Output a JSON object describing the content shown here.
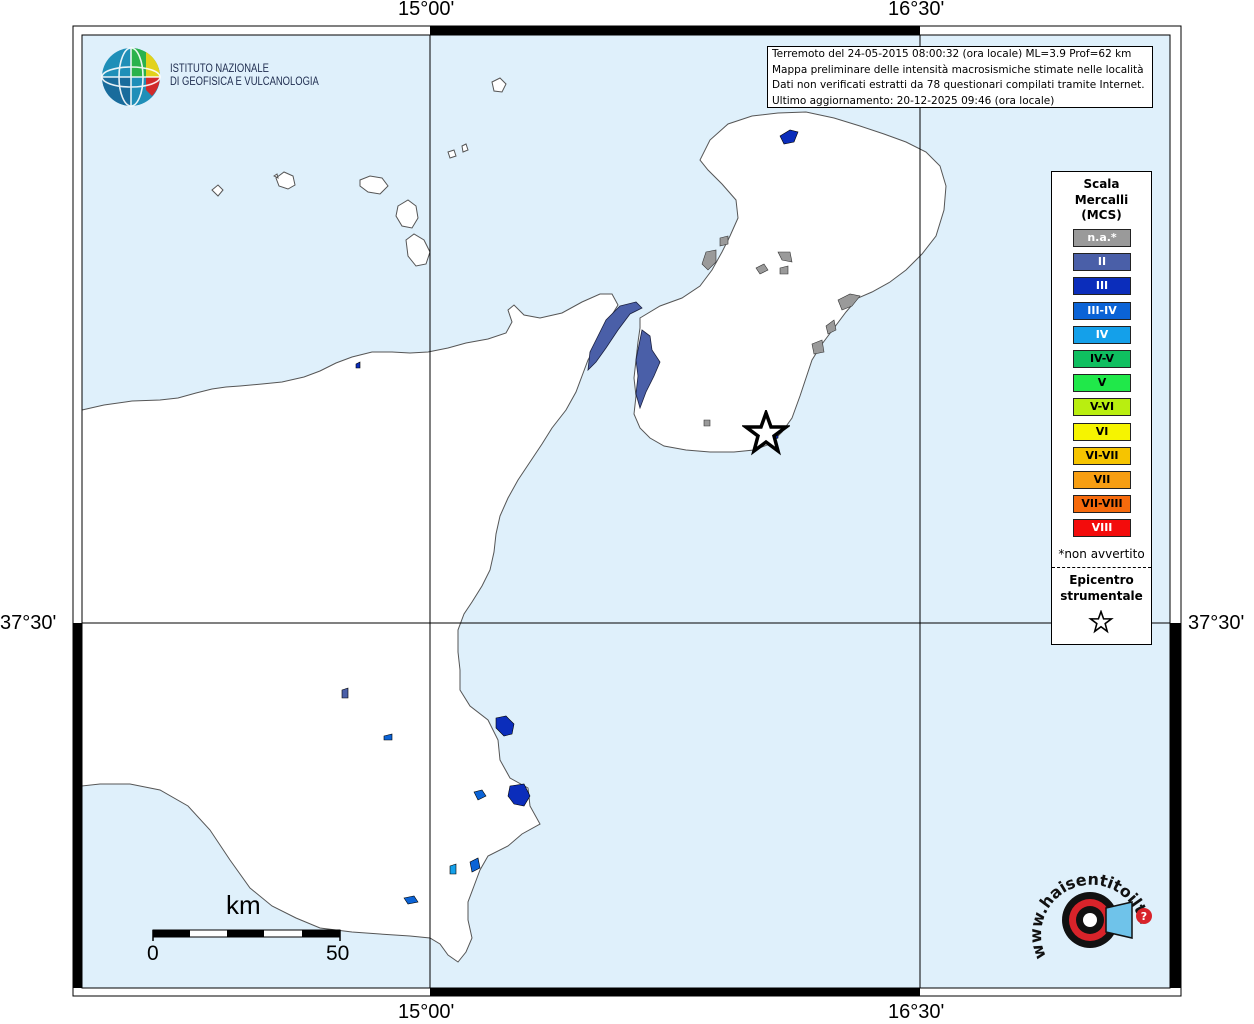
{
  "map": {
    "coords": {
      "top_left": "15°00'",
      "top_right": "16°30'",
      "bottom_left": "15°00'",
      "bottom_right": "16°30'",
      "left_lat": "37°30'",
      "right_lat": "37°30'"
    },
    "colors": {
      "sea": "#dff0fb",
      "land": "#ffffff",
      "coast": "#555555",
      "grid": "#000000"
    },
    "epicenter_symbol": "star-icon"
  },
  "info": {
    "line1": "Terremoto del 24-05-2015 08:00:32 (ora locale) ML=3.9 Prof=62 km",
    "line2": "Mappa preliminare delle intensità macrosismiche stimate nelle località",
    "line3": "Dati non verificati estratti da 78 questionari compilati tramite Internet.",
    "line4": "Ultimo aggiornamento: 20-12-2025 09:46 (ora locale)"
  },
  "legend": {
    "title1": "Scala",
    "title2": "Mercalli",
    "title3": "(MCS)",
    "classes": [
      {
        "label": "n.a.*",
        "color": "#9a9a9a",
        "text_color": "#ffffff"
      },
      {
        "label": "II",
        "color": "#4a5fa8",
        "text_color": "#ffffff"
      },
      {
        "label": "III",
        "color": "#0b2dbb",
        "text_color": "#ffffff"
      },
      {
        "label": "III-IV",
        "color": "#0b63d6",
        "text_color": "#ffffff"
      },
      {
        "label": "IV",
        "color": "#14a0ea",
        "text_color": "#ffffff"
      },
      {
        "label": "IV-V",
        "color": "#0fbf60",
        "text_color": "#000000"
      },
      {
        "label": "V",
        "color": "#20e84a",
        "text_color": "#000000"
      },
      {
        "label": "V-VI",
        "color": "#b9ee10",
        "text_color": "#000000"
      },
      {
        "label": "VI",
        "color": "#f6f400",
        "text_color": "#000000"
      },
      {
        "label": "VI-VII",
        "color": "#f6c400",
        "text_color": "#000000"
      },
      {
        "label": "VII",
        "color": "#f79e12",
        "text_color": "#000000"
      },
      {
        "label": "VII-VIII",
        "color": "#f66a0c",
        "text_color": "#000000"
      },
      {
        "label": "VIII",
        "color": "#f30c0c",
        "text_color": "#ffffff"
      }
    ],
    "note": "*non avvertito",
    "epi1": "Epicentro",
    "epi2": "strumentale"
  },
  "logo_ingv": {
    "line1": "ISTITUTO NAZIONALE",
    "line2": "DI GEOFISICA E VULCANOLOGIA"
  },
  "scalebar": {
    "unit": "km",
    "start": "0",
    "end": "50"
  },
  "logo_hst": {
    "text": "www.haisentitoilterremoto.it",
    "mark": "?"
  }
}
